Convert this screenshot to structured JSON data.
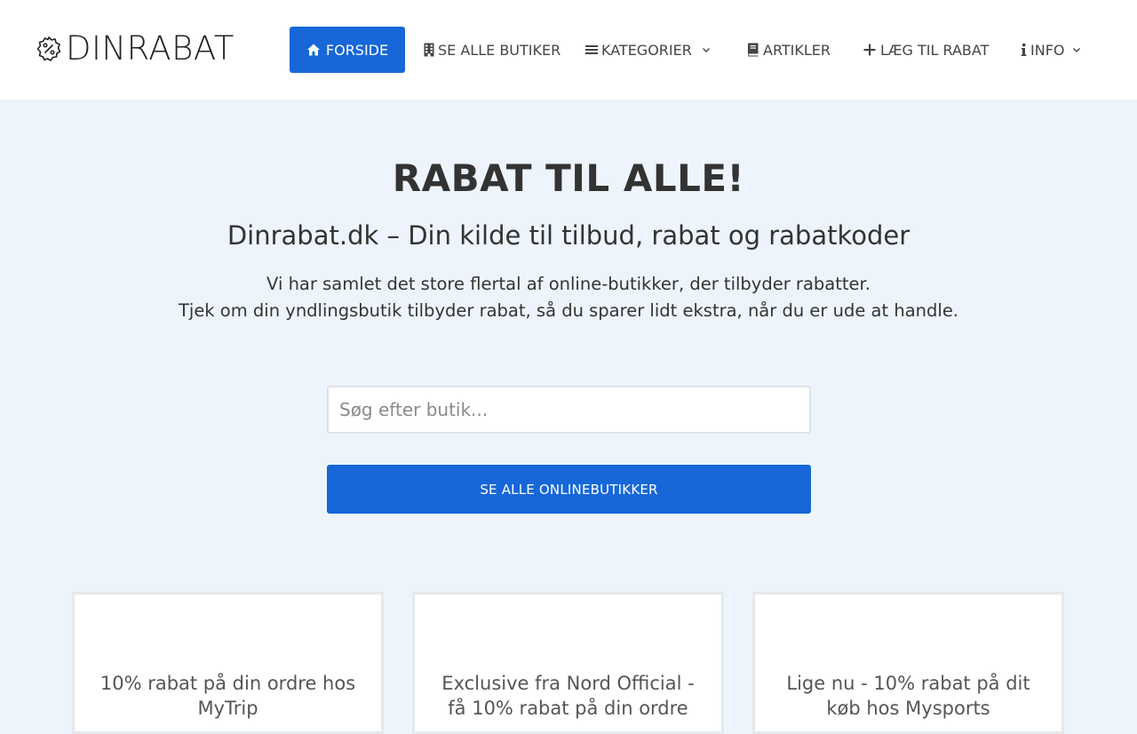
{
  "logo": {
    "text": "DINRABAT",
    "icon": "badge-percent-icon"
  },
  "nav": [
    {
      "label": "FORSIDE",
      "icon": "home-icon",
      "active": true
    },
    {
      "label": "SE ALLE BUTIKER",
      "icon": "building-icon"
    },
    {
      "label": "KATEGORIER",
      "icon": "bars-icon",
      "dropdown": true
    },
    {
      "label": "ARTIKLER",
      "icon": "book-icon"
    },
    {
      "label": "LÆG TIL RABAT",
      "icon": "plus-icon"
    },
    {
      "label": "INFO",
      "icon": "info-icon",
      "dropdown": true
    }
  ],
  "hero": {
    "title": "RABAT TIL ALLE!",
    "subtitle": "Dinrabat.dk – Din kilde til tilbud, rabat og rabatkoder",
    "desc_line1": "Vi har samlet det store flertal af online-butikker, der tilbyder rabatter.",
    "desc_line2": "Tjek om din yndlingsbutik tilbyder rabat, så du sparer lidt ekstra, når du er ude at handle."
  },
  "search": {
    "placeholder": "Søg efter butik..."
  },
  "cta": {
    "label": "SE ALLE ONLINEBUTIKKER"
  },
  "cards": [
    {
      "text": "10% rabat på din ordre hos MyTrip"
    },
    {
      "text": "Exclusive fra Nord Official - få 10% rabat på din ordre"
    },
    {
      "text": "Lige nu - 10% rabat på dit køb hos Mysports"
    }
  ],
  "colors": {
    "accent": "#1767d8",
    "background": "#eef4fb",
    "text": "#333333"
  }
}
